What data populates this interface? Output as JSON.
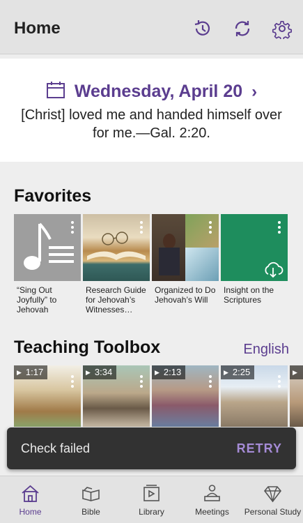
{
  "appbar": {
    "title": "Home",
    "actions": [
      {
        "icon": "history-icon"
      },
      {
        "icon": "sync-icon"
      },
      {
        "icon": "settings-icon"
      }
    ]
  },
  "daily_text": {
    "date": "Wednesday, April 20",
    "text": "[Christ] loved me and handed himself over for me.—Gal. 2:20."
  },
  "favorites": {
    "title": "Favorites",
    "items": [
      {
        "caption": "“Sing Out Joyfully” to Jehovah",
        "icon": "music-note-icon"
      },
      {
        "caption": "Research Guide for Jehovah’s Witnesses…"
      },
      {
        "caption": "Organized to Do Jehovah’s Will"
      },
      {
        "caption": "Insight on the Scriptures",
        "icon": "cloud-download-icon"
      }
    ]
  },
  "toolbox": {
    "title": "Teaching Toolbox",
    "language": "English",
    "videos": [
      {
        "duration": "1:17"
      },
      {
        "duration": "3:34"
      },
      {
        "duration": "2:13"
      },
      {
        "duration": "2:25"
      }
    ]
  },
  "snackbar": {
    "message": "Check failed",
    "action": "RETRY"
  },
  "nav": {
    "items": [
      {
        "label": "Home",
        "active": true
      },
      {
        "label": "Bible"
      },
      {
        "label": "Library"
      },
      {
        "label": "Meetings"
      },
      {
        "label": "Personal Study"
      }
    ]
  },
  "colors": {
    "accent": "#5b3d8f",
    "appbar": "#e3e3e3",
    "snackbar": "#323232",
    "snackbar_action": "#a58bd6"
  }
}
